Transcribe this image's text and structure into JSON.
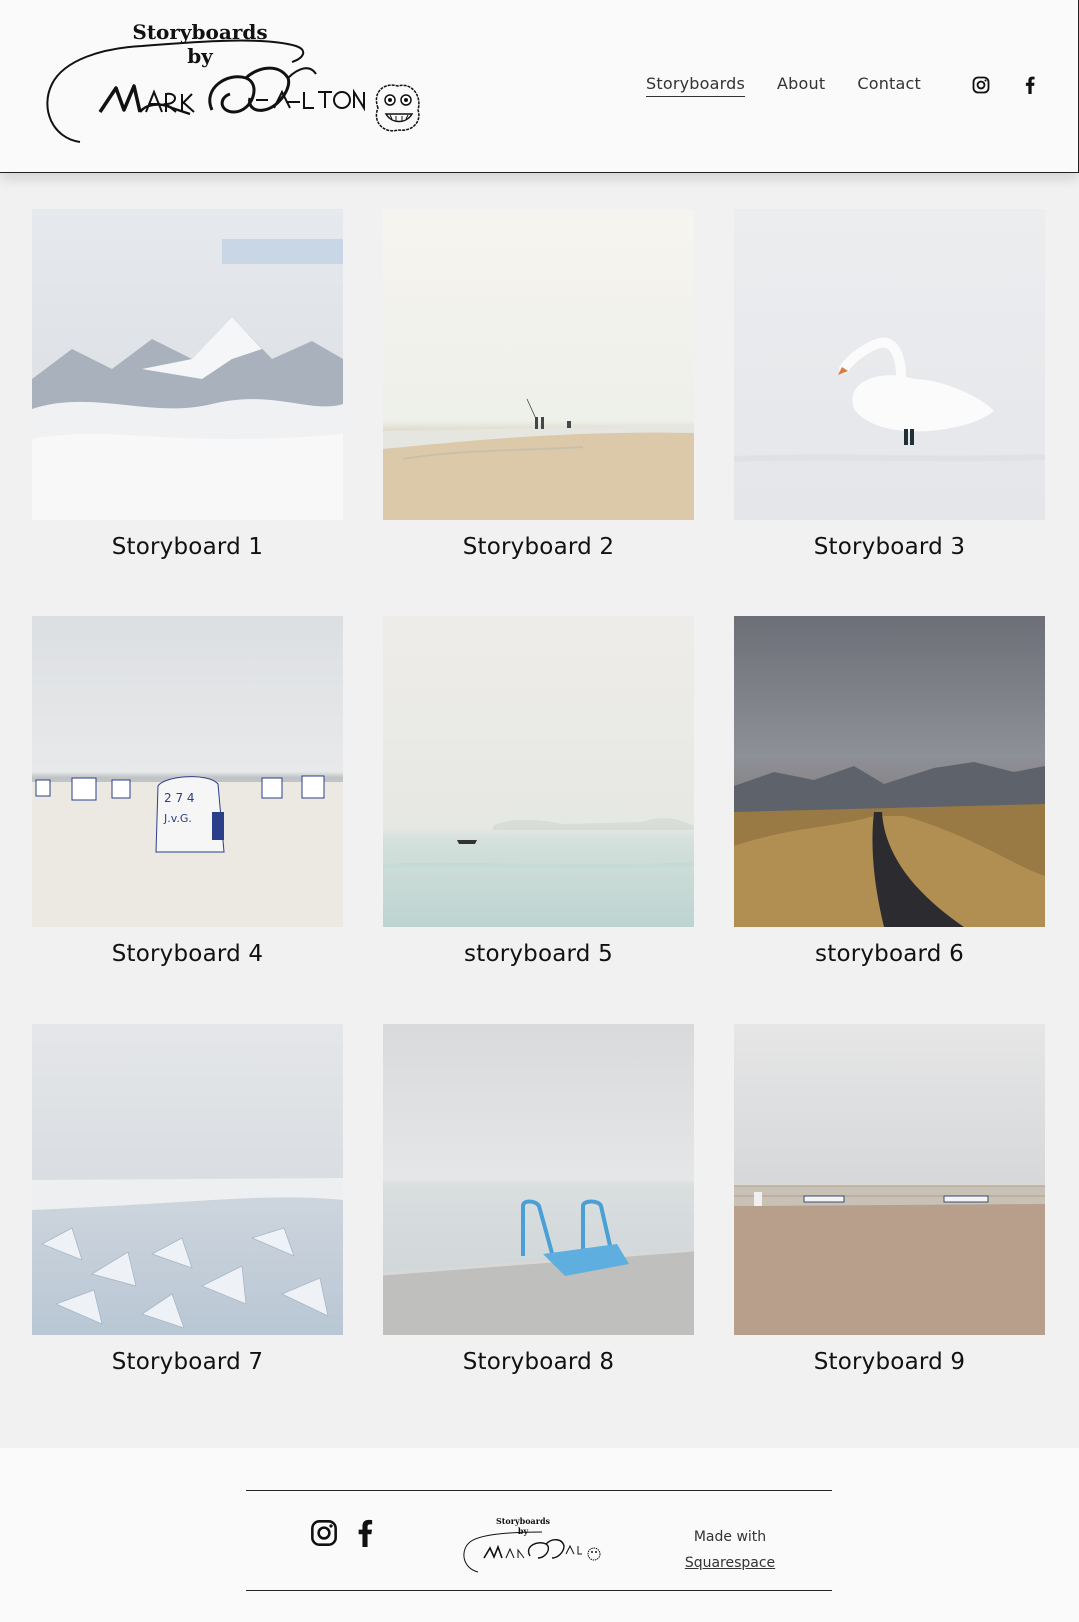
{
  "header": {
    "logo_title_line1": "Storyboards",
    "logo_title_line2": "by",
    "nav": [
      {
        "label": "Storyboards",
        "active": true
      },
      {
        "label": "About",
        "active": false
      },
      {
        "label": "Contact",
        "active": false
      }
    ],
    "social_icons": [
      "instagram-icon",
      "facebook-icon"
    ]
  },
  "gallery": [
    {
      "title": "Storyboard 1",
      "scene": "snowy-mountains-mist"
    },
    {
      "title": "Storyboard 2",
      "scene": "beach-fishermen-haze"
    },
    {
      "title": "Storyboard 3",
      "scene": "white-swan-water"
    },
    {
      "title": "Storyboard 4",
      "scene": "beach-chairs-sand"
    },
    {
      "title": "storyboard 5",
      "scene": "misty-sea-boat"
    },
    {
      "title": "storyboard 6",
      "scene": "mountain-road-autumn"
    },
    {
      "title": "Storyboard 7",
      "scene": "frozen-ice-shore"
    },
    {
      "title": "Storyboard 8",
      "scene": "pier-blue-ladder"
    },
    {
      "title": "Storyboard 9",
      "scene": "promenade-benches"
    }
  ],
  "footer": {
    "logo_title_line1": "Storyboards",
    "logo_title_line2": "by",
    "made_with": "Made with",
    "platform": "Squarespace"
  }
}
